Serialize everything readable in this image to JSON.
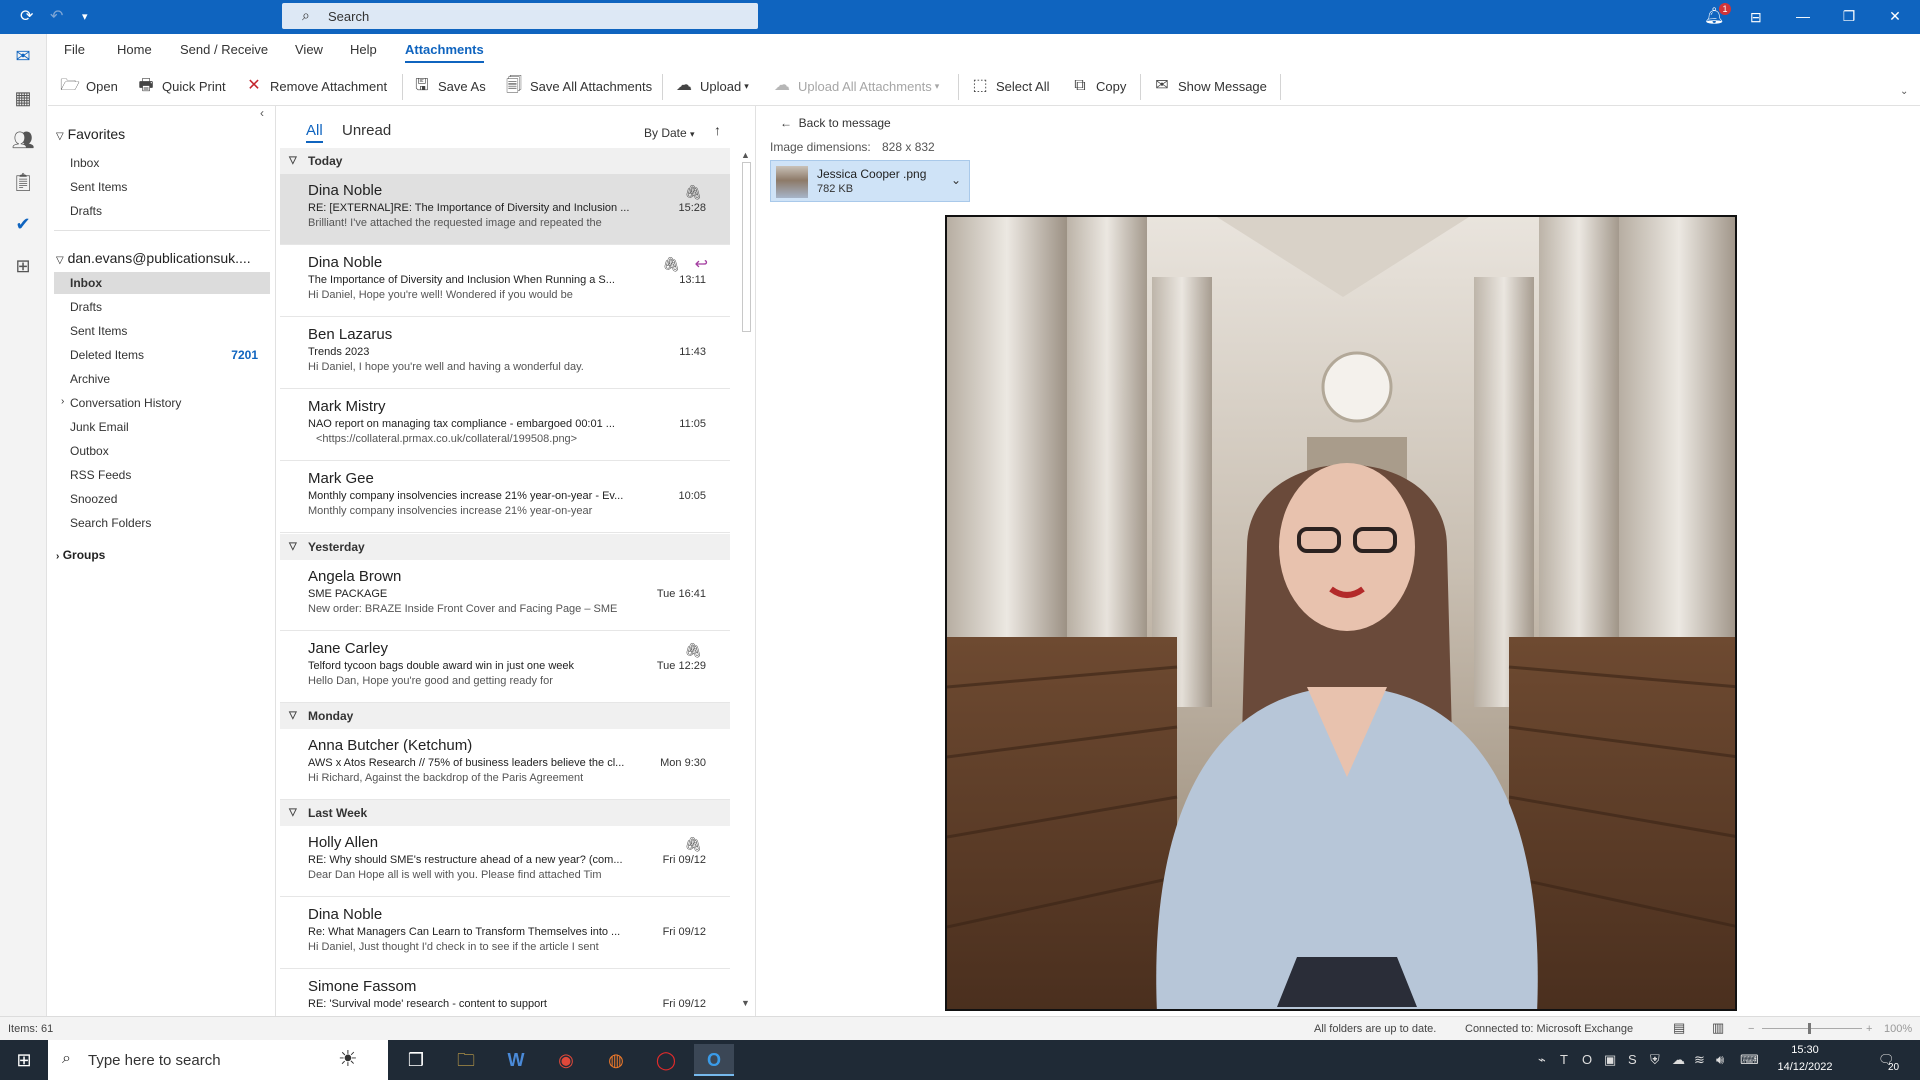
{
  "titlebar": {
    "search_placeholder": "Search",
    "notification_count": "1"
  },
  "ribbon_tabs": [
    {
      "label": "File"
    },
    {
      "label": "Home"
    },
    {
      "label": "Send / Receive"
    },
    {
      "label": "View"
    },
    {
      "label": "Help"
    },
    {
      "label": "Attachments",
      "active": true
    }
  ],
  "ribbon": {
    "open": "Open",
    "quick_print": "Quick Print",
    "remove_attachment": "Remove Attachment",
    "save_as": "Save As",
    "save_all": "Save All Attachments",
    "upload": "Upload",
    "upload_all": "Upload All Attachments",
    "select_all": "Select All",
    "copy": "Copy",
    "show_message": "Show Message"
  },
  "folders": {
    "favorites_label": "Favorites",
    "favorites": [
      "Inbox",
      "Sent Items",
      "Drafts"
    ],
    "account": "dan.evans@publicationsuk....",
    "items": [
      {
        "label": "Inbox",
        "selected": true
      },
      {
        "label": "Drafts"
      },
      {
        "label": "Sent Items"
      },
      {
        "label": "Deleted Items",
        "count": "7201"
      },
      {
        "label": "Archive"
      },
      {
        "label": "Conversation History"
      },
      {
        "label": "Junk Email"
      },
      {
        "label": "Outbox"
      },
      {
        "label": "RSS Feeds"
      },
      {
        "label": "Snoozed"
      },
      {
        "label": "Search Folders"
      }
    ],
    "groups_label": "Groups"
  },
  "message_list": {
    "filter_all": "All",
    "filter_unread": "Unread",
    "sort_label": "By Date",
    "groups": {
      "today": "Today",
      "yesterday": "Yesterday",
      "monday": "Monday",
      "last_week": "Last Week"
    },
    "messages": [
      {
        "from": "Dina Noble",
        "subject": "RE: [EXTERNAL]RE: The Importance of Diversity and Inclusion ...",
        "preview": "Brilliant!  I've attached the requested image and repeated the",
        "time": "15:28"
      },
      {
        "from": "Dina Noble",
        "subject": "The Importance of Diversity and Inclusion When Running a S...",
        "preview": "Hi Daniel,   Hope you're well! Wondered if you would be",
        "time": "13:11"
      },
      {
        "from": "Ben Lazarus",
        "subject": "Trends 2023",
        "preview": "Hi Daniel, I hope you're well and having a wonderful day.",
        "time": "11:43"
      },
      {
        "from": "Mark Mistry",
        "subject": "NAO report on managing tax compliance - embargoed 00:01 ...",
        "preview": "<https://collateral.prmax.co.uk/collateral/199508.png>",
        "time": "11:05"
      },
      {
        "from": "Mark Gee",
        "subject": "Monthly company insolvencies increase 21% year-on-year - Ev...",
        "preview": "Monthly company insolvencies increase 21% year-on-year",
        "time": "10:05"
      },
      {
        "from": "Angela Brown",
        "subject": "SME PACKAGE",
        "preview": "New order:  BRAZE  Inside Front Cover and Facing Page – SME",
        "time": "Tue 16:41"
      },
      {
        "from": "Jane Carley",
        "subject": "Telford tycoon bags double award win in just one week",
        "preview": "Hello Dan,  Hope you're good and getting ready for",
        "time": "Tue 12:29"
      },
      {
        "from": "Anna Butcher (Ketchum)",
        "subject": "AWS x Atos Research // 75% of business leaders believe the cl...",
        "preview": "Hi Richard,   Against the backdrop of the Paris Agreement",
        "time": "Mon 9:30"
      },
      {
        "from": "Holly Allen",
        "subject": "RE: Why should SME's restructure ahead of a new year? (com...",
        "preview": "Dear Dan  Hope all is well with you.   Please find attached Tim",
        "time": "Fri 09/12"
      },
      {
        "from": "Dina Noble",
        "subject": "Re: What Managers Can Learn to Transform Themselves into ...",
        "preview": "Hi Daniel,   Just thought I'd check in to see if the article I sent",
        "time": "Fri 09/12"
      },
      {
        "from": "Simone Fassom",
        "subject": "RE: 'Survival mode' research - content to support",
        "preview": "",
        "time": "Fri 09/12"
      }
    ]
  },
  "reading": {
    "back_label": "Back to message",
    "dims_label": "Image dimensions:",
    "dims_value": "828 x 832",
    "attachment_name": "Jessica Cooper .png",
    "attachment_size": "782 KB"
  },
  "statusbar": {
    "items": "Items: 61",
    "sync": "All folders are up to date.",
    "connection": "Connected to: Microsoft Exchange",
    "zoom": "100%"
  },
  "taskbar": {
    "search_placeholder": "Type here to search",
    "time": "15:30",
    "date": "14/12/2022",
    "notif_count": "20"
  }
}
